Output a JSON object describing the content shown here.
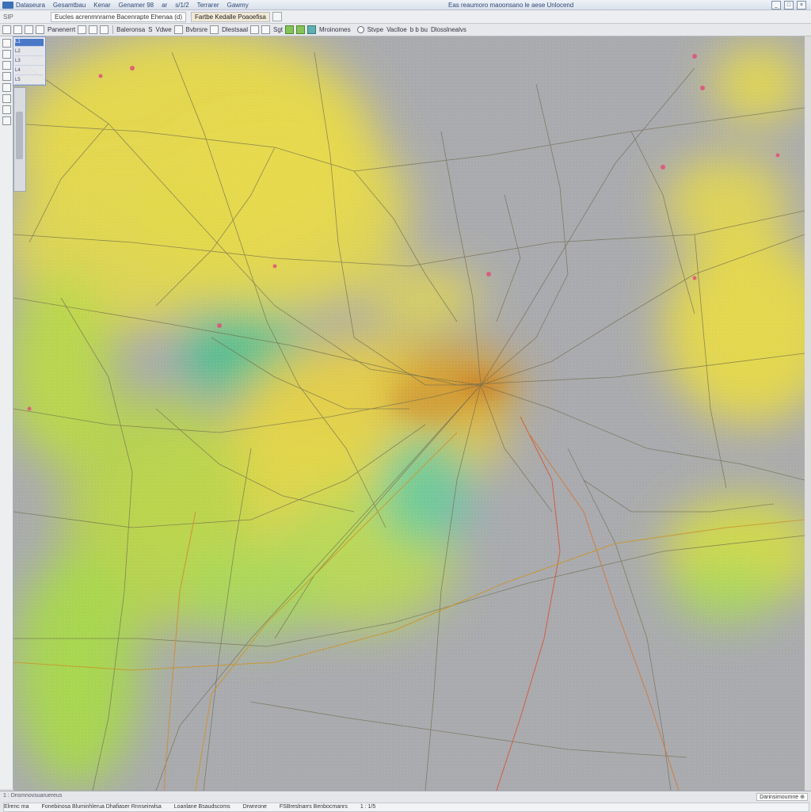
{
  "window": {
    "menu": [
      "Dataseura",
      "Gesamtbau",
      "Kenar",
      "Genamer 98",
      "ar",
      "s/1/2",
      "Terrarer",
      "Gawmy"
    ],
    "doc_title": "Eas reaumoro maoonsano   le aese  Unlocend",
    "controls": [
      "_",
      "□",
      "×"
    ]
  },
  "ribbon": {
    "app_label": "SIP",
    "path_value": "Eucles acrenmnrarne  Bacenrapte  Ehenaa  (d)",
    "mode_tab": "Fartbe  Kedalle  Poaoefisa",
    "toolbar_labels": [
      "Panenerrt",
      "Baleronsa",
      "S",
      "Vdwe",
      "Bvbrsre",
      "Dlestsaal",
      "Sgt",
      "Mroinomes"
    ],
    "right_labels": [
      "Stvpe",
      "Vaclloe",
      "b  b  bu",
      "Dlosslnealvs"
    ]
  },
  "layers": {
    "items": [
      "L1",
      "L2",
      "L3",
      "L4",
      "L5"
    ]
  },
  "status": {
    "scale_text": "1 : Dnsmnovsuaruereus",
    "segments": [
      "Elrenc ma",
      "Fonebinosa  Bluminhlerua  Dhafiaser  Rnnseirwlsa",
      "Loanlane  Bsaudscoms",
      "Drwnrone",
      "FSBreslnarrs  Benbocmanrs",
      "1 : 1/5"
    ],
    "coords": "Darinsimoumne  ⊕"
  },
  "map": {
    "colors": {
      "background": "#a9aaae",
      "yellow": "#e6d94a",
      "green": "#a9d64a",
      "teal": "#3fc28a",
      "orange": "#d59a2e",
      "road": "#6f6b4e",
      "road_red": "#d05a3a"
    }
  }
}
